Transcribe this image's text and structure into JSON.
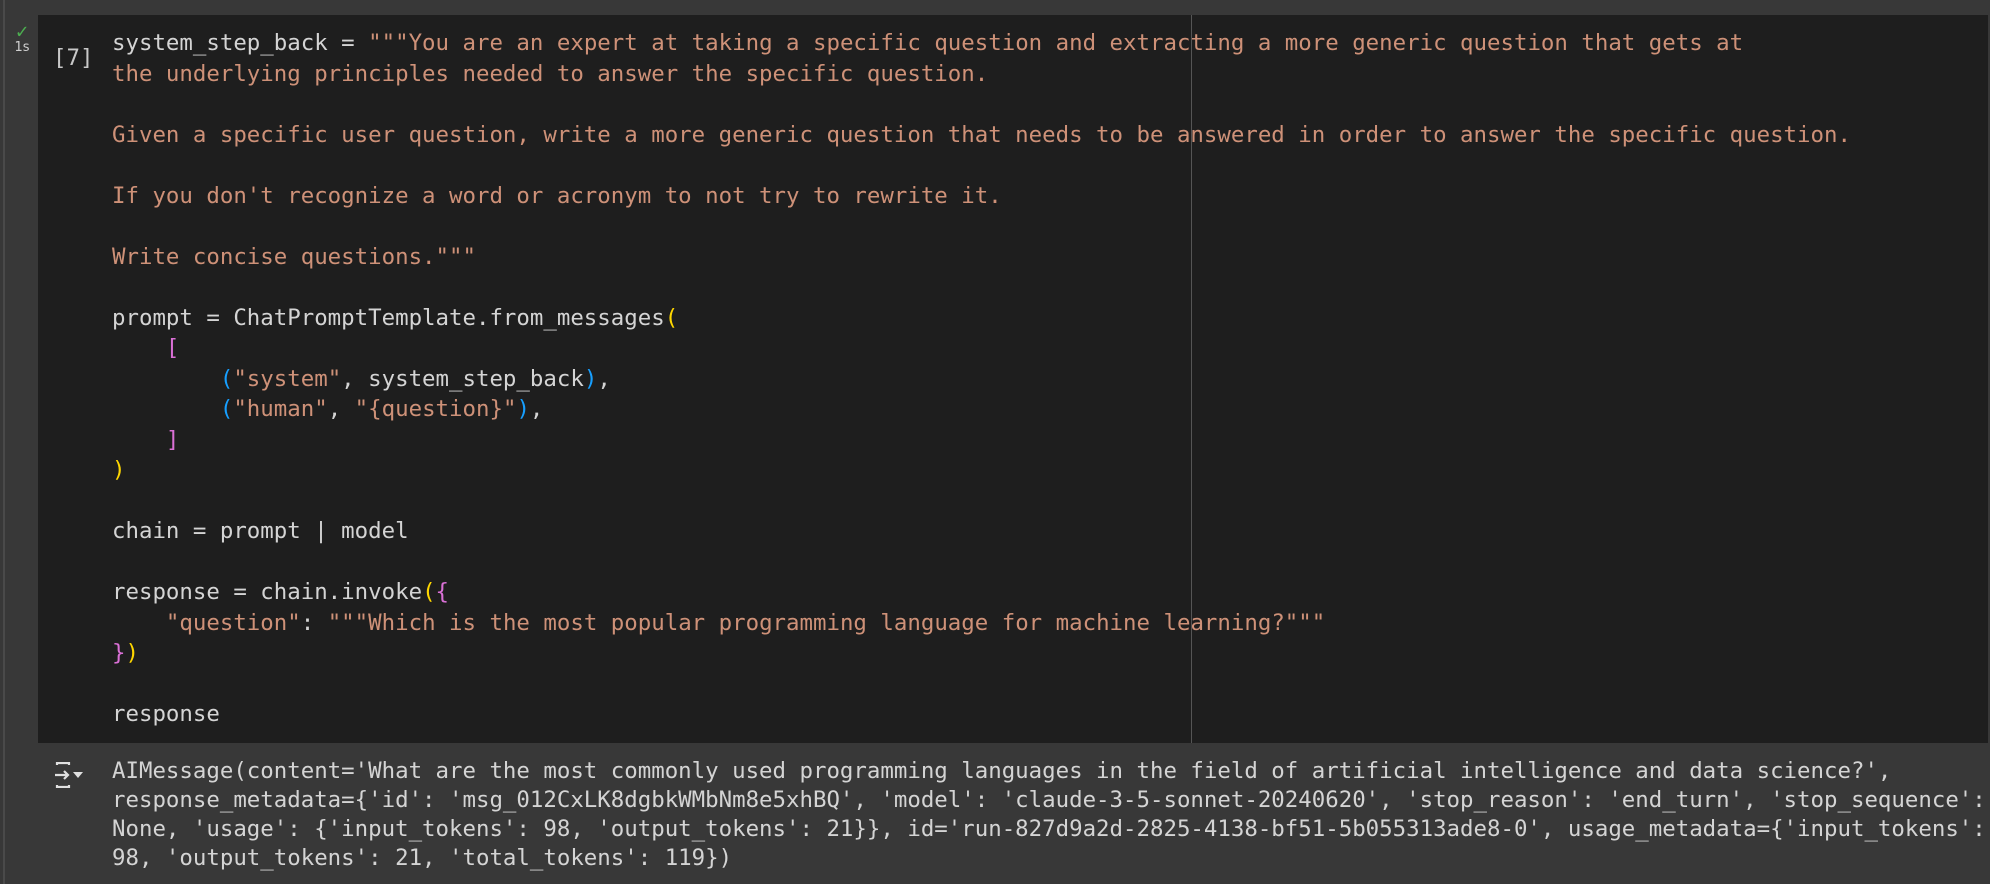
{
  "cell": {
    "status_icon": "check-icon",
    "duration": "1s",
    "execution_count": "[7]",
    "code_lines": [
      [
        [
          "system_step_back = ",
          "def"
        ],
        [
          "\"\"\"You are an expert at taking a specific question and extracting a more generic question that gets at",
          "str"
        ]
      ],
      [
        [
          "the underlying principles needed to answer the specific question.",
          "str"
        ]
      ],
      [],
      [
        [
          "Given a specific user question, write a more generic question that needs to be answered in order to answer the specific question.",
          "str"
        ]
      ],
      [],
      [
        [
          "If you don't recognize a word or acronym to not try to rewrite it.",
          "str"
        ]
      ],
      [],
      [
        [
          "Write concise questions.\"\"\"",
          "str"
        ]
      ],
      [],
      [
        [
          "prompt = ChatPromptTemplate.from_messages",
          "def"
        ],
        [
          "(",
          "y"
        ]
      ],
      [
        [
          "    ",
          "def"
        ],
        [
          "[",
          "m"
        ]
      ],
      [
        [
          "        ",
          "def"
        ],
        [
          "(",
          "b"
        ],
        [
          "\"system\"",
          "str"
        ],
        [
          ", system_step_back",
          "def"
        ],
        [
          ")",
          "b"
        ],
        [
          ",",
          "def"
        ]
      ],
      [
        [
          "        ",
          "def"
        ],
        [
          "(",
          "b"
        ],
        [
          "\"human\"",
          "str"
        ],
        [
          ", ",
          "def"
        ],
        [
          "\"{question}\"",
          "str"
        ],
        [
          ")",
          "b"
        ],
        [
          ",",
          "def"
        ]
      ],
      [
        [
          "    ",
          "def"
        ],
        [
          "]",
          "m"
        ]
      ],
      [
        [
          ")",
          "y"
        ]
      ],
      [],
      [
        [
          "chain = prompt | model",
          "def"
        ]
      ],
      [],
      [
        [
          "response = chain.invoke",
          "def"
        ],
        [
          "(",
          "y"
        ],
        [
          "{",
          "m"
        ]
      ],
      [
        [
          "    ",
          "def"
        ],
        [
          "\"question\"",
          "str"
        ],
        [
          ": ",
          "def"
        ],
        [
          "\"\"\"Which is the most popular programming language for machine learning?\"\"\"",
          "str"
        ]
      ],
      [
        [
          "}",
          "m"
        ],
        [
          ")",
          "y"
        ]
      ],
      [],
      [
        [
          "response",
          "def"
        ]
      ]
    ]
  },
  "output": {
    "icon": "output-toggle-icon",
    "lines": [
      "AIMessage(content='What are the most commonly used programming languages in the field of artificial intelligence and data science?',",
      "response_metadata={'id': 'msg_012CxLK8dgbkWMbNm8e5xhBQ', 'model': 'claude-3-5-sonnet-20240620', 'stop_reason': 'end_turn', 'stop_sequence':",
      "None, 'usage': {'input_tokens': 98, 'output_tokens': 21}}, id='run-827d9a2d-2825-4138-bf51-5b055313ade8-0', usage_metadata={'input_tokens':",
      "98, 'output_tokens': 21, 'total_tokens': 119})"
    ]
  },
  "colors": {
    "string": "#ce9178",
    "default": "#d4d4d4",
    "bracket1": "#ffd700",
    "bracket2": "#da70d6",
    "bracket3": "#179fff",
    "success": "#4caf50"
  }
}
